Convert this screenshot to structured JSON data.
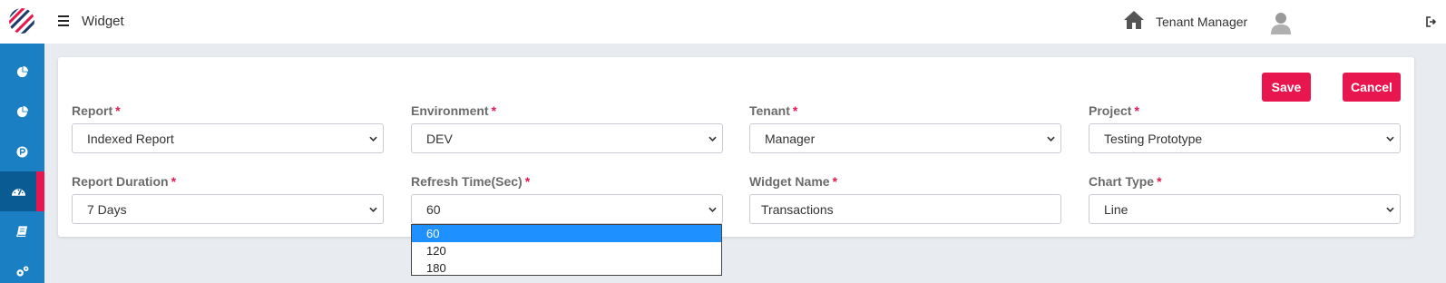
{
  "header": {
    "app_title": "Widget",
    "tenant_label": "Tenant Manager"
  },
  "sidebar": {
    "items": [
      {
        "icon": "pie-chart-icon"
      },
      {
        "icon": "pie-chart-icon"
      },
      {
        "icon": "parking-icon"
      },
      {
        "icon": "dashboard-icon",
        "active": true
      },
      {
        "icon": "book-icon"
      },
      {
        "icon": "settings-gears-icon"
      }
    ]
  },
  "actions": {
    "save_label": "Save",
    "cancel_label": "Cancel"
  },
  "form": {
    "required_mark": "*",
    "report": {
      "label": "Report",
      "value": "Indexed Report"
    },
    "environment": {
      "label": "Environment",
      "value": "DEV"
    },
    "tenant": {
      "label": "Tenant",
      "value": "Manager"
    },
    "project": {
      "label": "Project",
      "value": "Testing Prototype"
    },
    "report_duration": {
      "label": "Report Duration",
      "value": "7 Days"
    },
    "refresh_time": {
      "label": "Refresh Time(Sec)",
      "value": "60",
      "options": [
        "60",
        "120",
        "180"
      ]
    },
    "widget_name": {
      "label": "Widget Name",
      "value": "Transactions"
    },
    "chart_type": {
      "label": "Chart Type",
      "value": "Line"
    }
  },
  "colors": {
    "accent": "#e8164f",
    "sidebar": "#1b7fc4",
    "selected_option": "#1e90ff"
  }
}
